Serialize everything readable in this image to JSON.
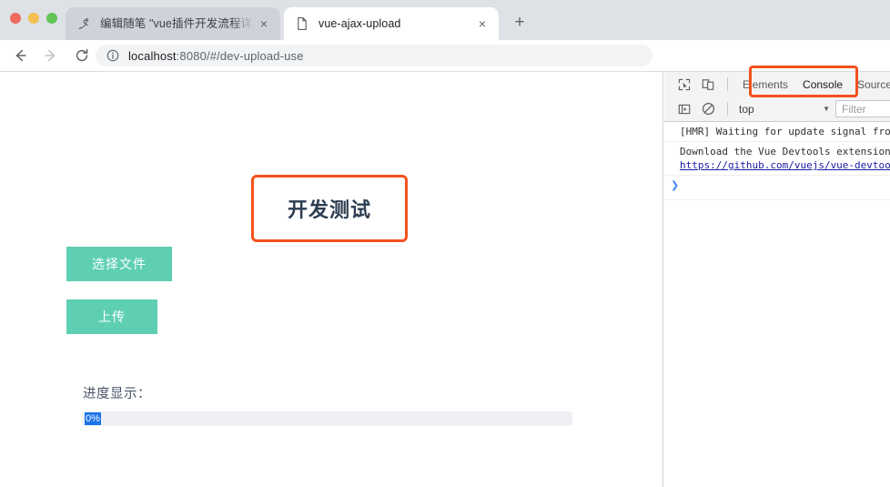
{
  "window": {
    "controls": [
      "close",
      "minimize",
      "maximize"
    ]
  },
  "tabs": [
    {
      "title": "编辑随笔 \"vue插件开发流程详解",
      "favicon": "script-pen-icon",
      "active": false,
      "close_label": "×"
    },
    {
      "title": "vue-ajax-upload",
      "favicon": "blank-page-icon",
      "active": true,
      "close_label": "×"
    }
  ],
  "new_tab_label": "+",
  "toolbar": {
    "back_label": "←",
    "forward_label": "→",
    "reload_label": "⟳",
    "site_info_icon": "info-circle-icon",
    "url_host": "localhost",
    "url_rest": ":8080/#/dev-upload-use"
  },
  "page": {
    "title": "开发测试",
    "choose_file_button": "选择文件",
    "upload_button": "上传",
    "progress_label": "进度显示：",
    "progress_value_text": "0%",
    "progress_percent": 0,
    "accent_teal": "#5fcfb4",
    "annotation_color": "#f4511e",
    "selection_color": "#1a73e8"
  },
  "devtools": {
    "inspect_icon": "inspect-element-icon",
    "device_icon": "device-toolbar-icon",
    "panels": [
      {
        "label": "Elements",
        "active": false
      },
      {
        "label": "Console",
        "active": true
      },
      {
        "label": "Sources",
        "active": false
      }
    ],
    "sidebar_icon": "console-sidebar-icon",
    "clear_icon": "clear-console-icon",
    "context": "top",
    "context_caret": "▼",
    "filter_placeholder": "Filter",
    "messages": [
      {
        "text": "[HMR] Waiting for update signal from WDS...",
        "link": null
      },
      {
        "text": "Download the Vue Devtools extension for a better development experience:",
        "link": "https://github.com/vuejs/vue-devtools"
      }
    ],
    "prompt_symbol": "❯"
  }
}
